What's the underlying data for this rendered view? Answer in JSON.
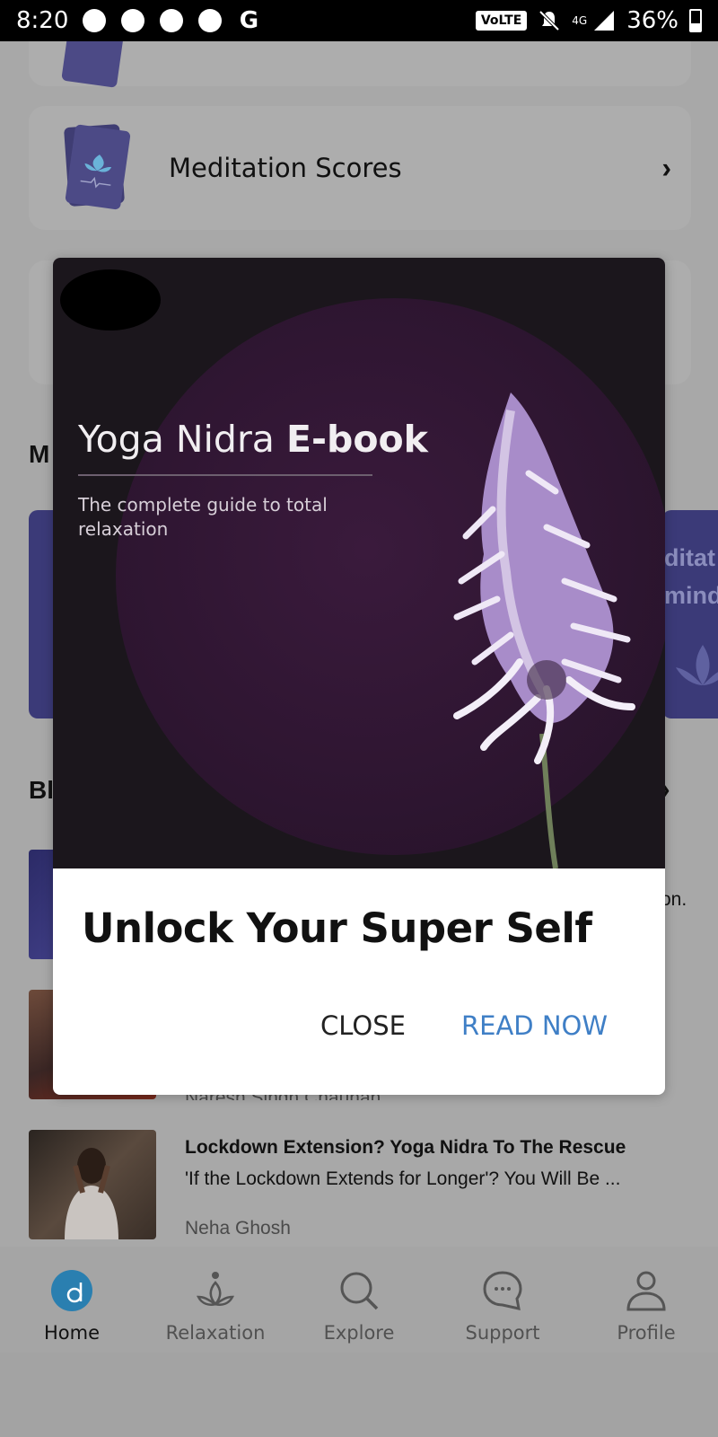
{
  "status_bar": {
    "time": "8:20",
    "g_label": "G",
    "volte": "VoLTE",
    "network": "4G",
    "battery": "36%"
  },
  "background": {
    "cards": [
      {
        "label": "Meditation Scores"
      }
    ],
    "partial_headings": {
      "section_1": "M",
      "section_2": "Bl"
    },
    "banner_partial": {
      "line1": "ditat",
      "line2": "mind"
    },
    "blog_partial_snippet": "on.",
    "blog_partial_author": "Naresh Singh Chauhan",
    "blog": {
      "title": "Lockdown Extension? Yoga Nidra To The Rescue",
      "snippet": "'If the Lockdown Extends for Longer'? You Will Be ...",
      "author": "Neha Ghosh"
    }
  },
  "modal": {
    "ebook_title_regular": "Yoga Nidra ",
    "ebook_title_bold": "E-book",
    "ebook_subtitle": "The complete guide to total relaxation",
    "title": "Unlock Your Super Self",
    "close_label": "CLOSE",
    "read_label": "READ NOW"
  },
  "bottom_nav": {
    "items": [
      {
        "label": "Home",
        "icon": "home-d-icon"
      },
      {
        "label": "Relaxation",
        "icon": "lotus-icon"
      },
      {
        "label": "Explore",
        "icon": "search-icon"
      },
      {
        "label": "Support",
        "icon": "chat-bubble-icon"
      },
      {
        "label": "Profile",
        "icon": "person-icon"
      }
    ],
    "active": "Home"
  },
  "colors": {
    "accent_blue": "#3f7fc6",
    "home_icon": "#2a7fb0",
    "card_purple": "#4c4a86"
  }
}
